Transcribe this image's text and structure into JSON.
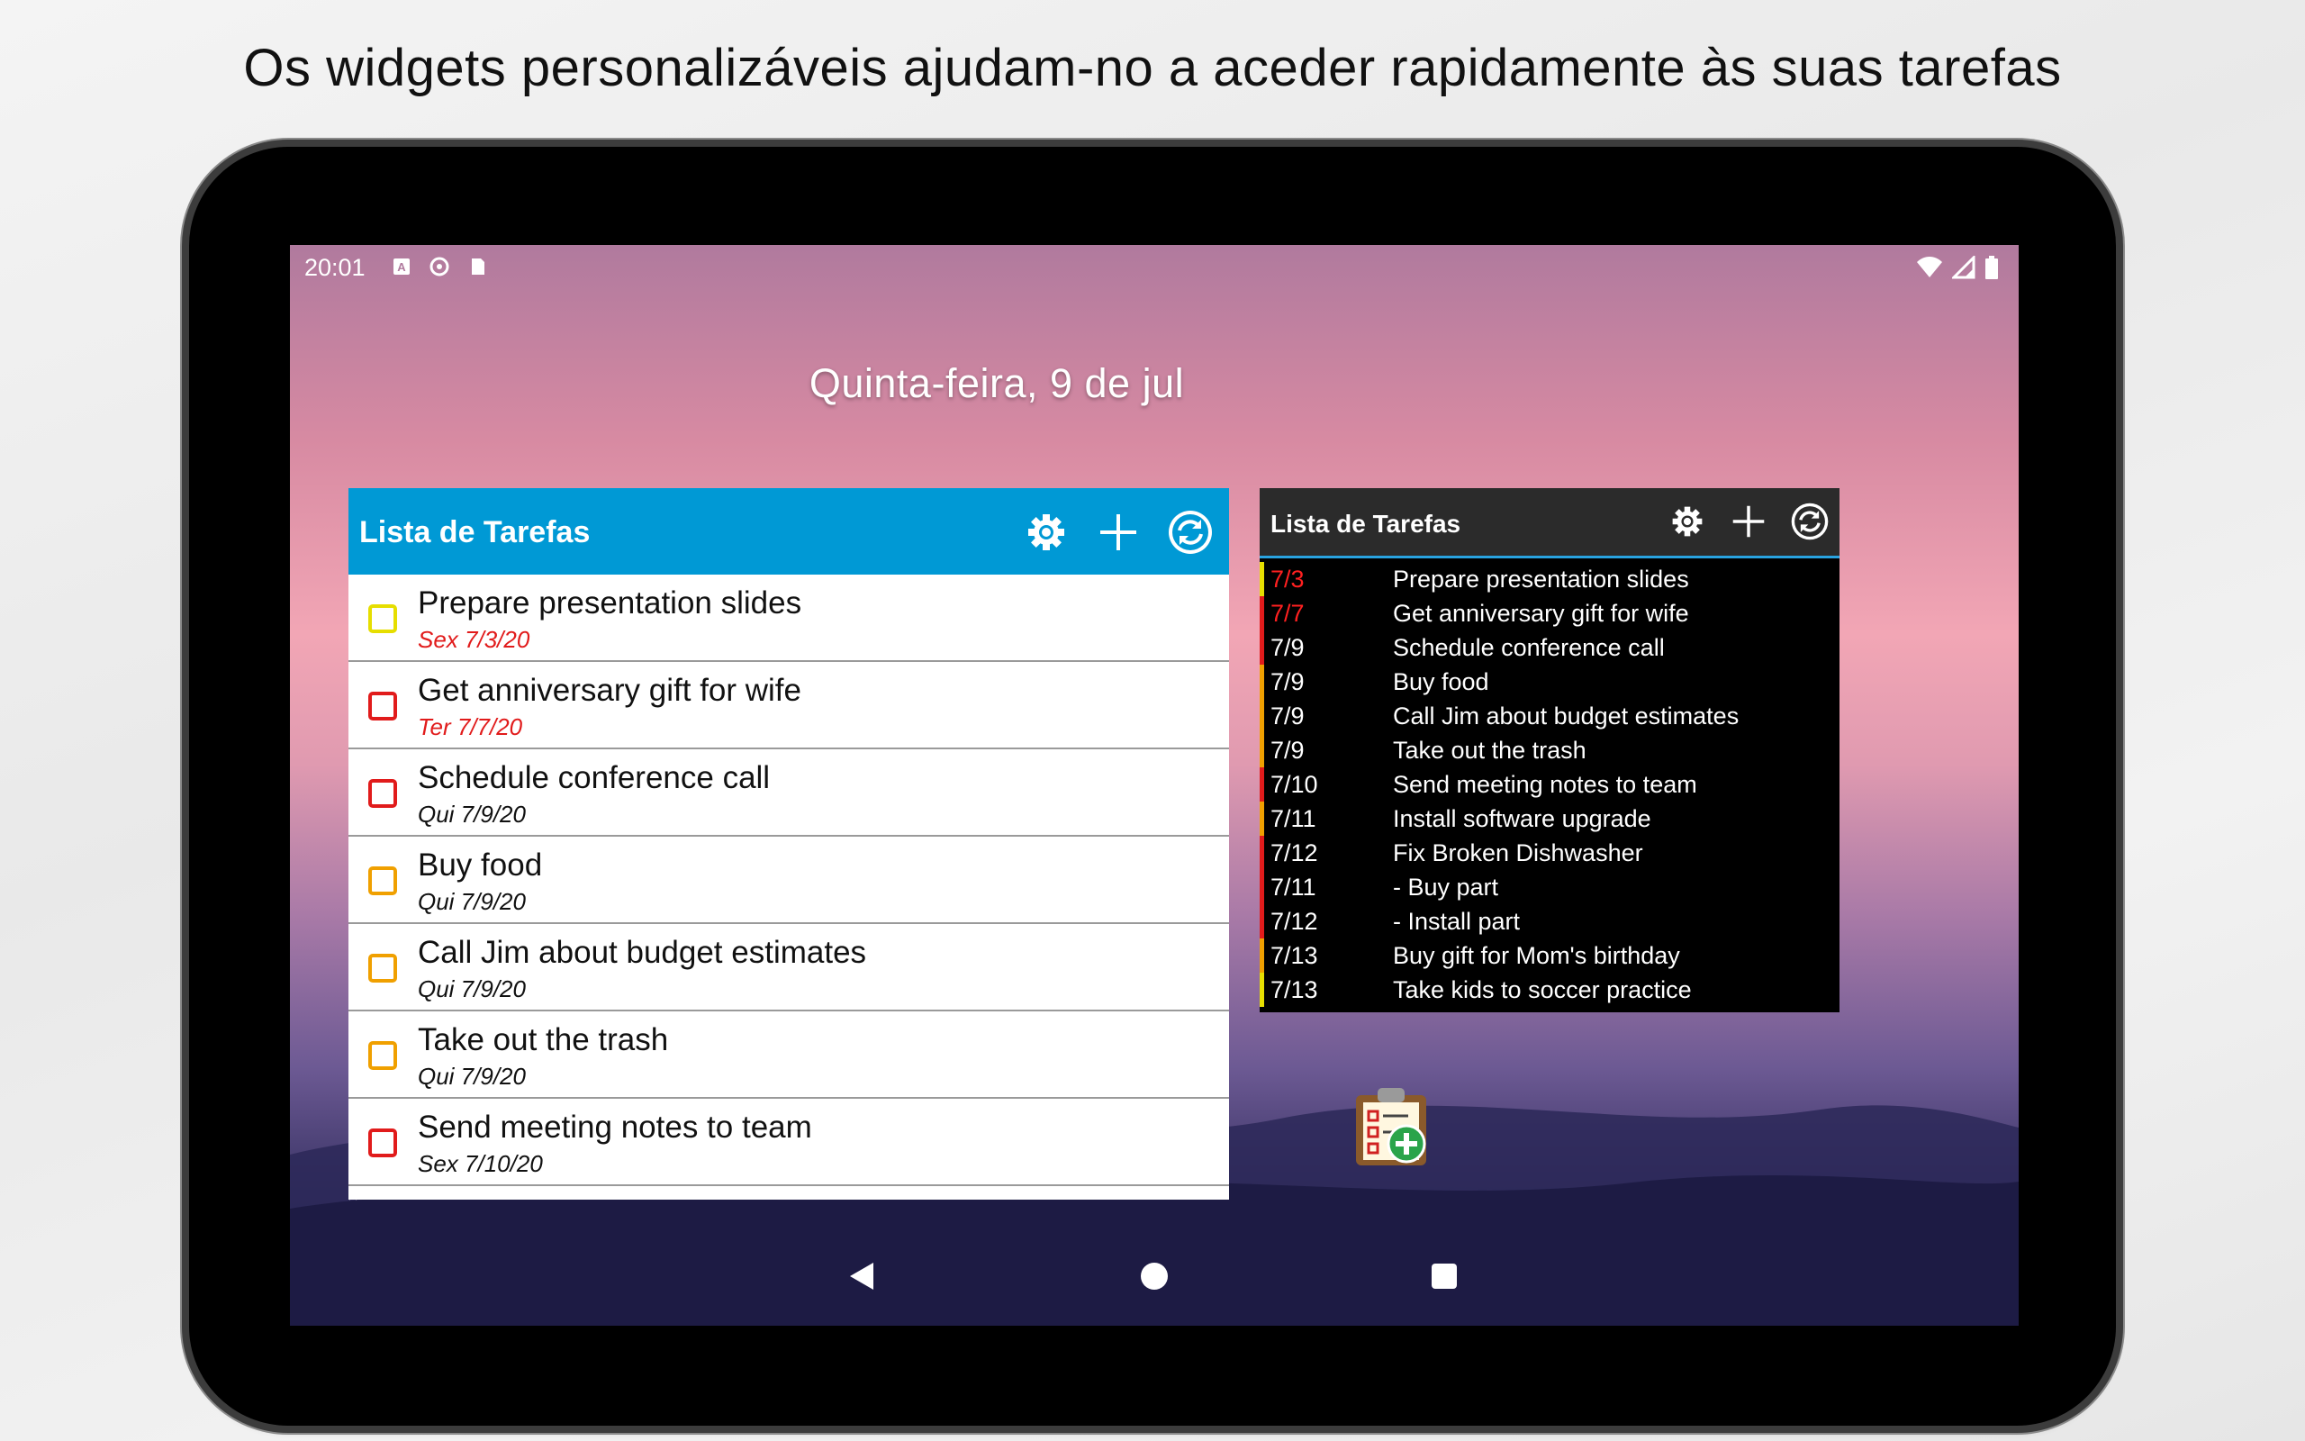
{
  "headline": "Os widgets personalizáveis ajudam-no a aceder rapidamente às suas tarefas",
  "status_bar": {
    "time": "20:01"
  },
  "home_date": "Quinta-feira, 9 de jul",
  "widget_light": {
    "title": "Lista de Tarefas",
    "icons": [
      "gear-icon",
      "plus-icon",
      "sync-icon"
    ],
    "tasks": [
      {
        "name": "Prepare presentation slides",
        "date": "Sex 7/3/20",
        "date_color": "#e11b1b",
        "box_color": "#e6de00"
      },
      {
        "name": "Get anniversary gift for wife",
        "date": "Ter 7/7/20",
        "date_color": "#e11b1b",
        "box_color": "#e11b1b"
      },
      {
        "name": "Schedule conference call",
        "date": "Qui 7/9/20",
        "date_color": "#111111",
        "box_color": "#e11b1b"
      },
      {
        "name": "Buy food",
        "date": "Qui 7/9/20",
        "date_color": "#111111",
        "box_color": "#f0a000"
      },
      {
        "name": "Call Jim about budget estimates",
        "date": "Qui 7/9/20",
        "date_color": "#111111",
        "box_color": "#f0a000"
      },
      {
        "name": "Take out the trash",
        "date": "Qui 7/9/20",
        "date_color": "#111111",
        "box_color": "#f0a000"
      },
      {
        "name": "Send meeting notes to team",
        "date": "Sex 7/10/20",
        "date_color": "#111111",
        "box_color": "#e11b1b"
      }
    ]
  },
  "widget_dark": {
    "title": "Lista de Tarefas",
    "icons": [
      "gear-icon",
      "plus-icon",
      "sync-icon"
    ],
    "tasks": [
      {
        "date": "7/3",
        "name": "Prepare presentation slides",
        "date_color": "#ff2020",
        "bar_color": "#e6de00"
      },
      {
        "date": "7/7",
        "name": "Get anniversary gift for wife",
        "date_color": "#ff2020",
        "bar_color": "#e11b1b"
      },
      {
        "date": "7/9",
        "name": "Schedule conference call",
        "date_color": "#ffffff",
        "bar_color": "#e11b1b"
      },
      {
        "date": "7/9",
        "name": "Buy food",
        "date_color": "#ffffff",
        "bar_color": "#f0a000"
      },
      {
        "date": "7/9",
        "name": "Call Jim about budget estimates",
        "date_color": "#ffffff",
        "bar_color": "#f0a000"
      },
      {
        "date": "7/9",
        "name": "Take out the trash",
        "date_color": "#ffffff",
        "bar_color": "#f0a000"
      },
      {
        "date": "7/10",
        "name": "Send meeting notes to team",
        "date_color": "#ffffff",
        "bar_color": "#e11b1b"
      },
      {
        "date": "7/11",
        "name": "Install software upgrade",
        "date_color": "#ffffff",
        "bar_color": "#f0a000"
      },
      {
        "date": "7/12",
        "name": "Fix Broken Dishwasher",
        "date_color": "#ffffff",
        "bar_color": "#e11b1b"
      },
      {
        "date": "7/11",
        "name": "- Buy part",
        "date_color": "#ffffff",
        "bar_color": "#e11b1b"
      },
      {
        "date": "7/12",
        "name": "- Install part",
        "date_color": "#ffffff",
        "bar_color": "#e11b1b"
      },
      {
        "date": "7/13",
        "name": "Buy gift for Mom's birthday",
        "date_color": "#ffffff",
        "bar_color": "#f0a000"
      },
      {
        "date": "7/13",
        "name": "Take kids to soccer practice",
        "date_color": "#ffffff",
        "bar_color": "#e6de00"
      }
    ]
  },
  "colors": {
    "light_header": "#0099d5",
    "dark_header": "#2b2b2b",
    "dark_accent": "#29a3e0"
  }
}
